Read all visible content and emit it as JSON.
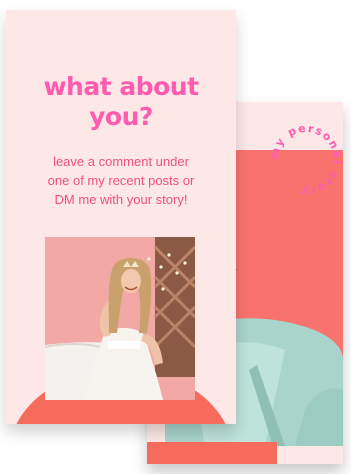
{
  "front_card": {
    "headline_line1": "what about",
    "headline_line2": "you?",
    "body_line1": "leave a comment under",
    "body_line2": "one of my recent posts or",
    "body_line3": "DM me with your story!"
  },
  "back_card": {
    "badge_text": "my personal story"
  },
  "colors": {
    "card_background": "#fde7e7",
    "headline_pink": "#ff5cb0",
    "body_pink": "#f0517f",
    "coral": "#f66c5c"
  }
}
